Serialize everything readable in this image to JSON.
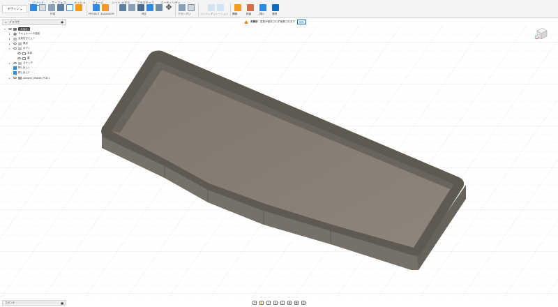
{
  "toolbar": {
    "workspace_label": "デザイン",
    "tabs": [
      {
        "label": "ソリッド",
        "active": true
      },
      {
        "label": "サーフェス",
        "active": false
      },
      {
        "label": "メッシュ",
        "active": false
      },
      {
        "label": "フォーム",
        "active": false
      },
      {
        "label": "シート メタル",
        "active": false
      },
      {
        "label": "プラスチック",
        "active": false
      },
      {
        "label": "ユーティリティ",
        "active": false
      }
    ],
    "groups": {
      "create": "作成",
      "project_salvador": "PROJECT SALVADOR",
      "modify": "修正",
      "assemble": "アセンブリ",
      "configure": "コンフィギュレーション",
      "construct": "構築",
      "inspect": "検査",
      "insert": "挿入",
      "select": "選択"
    }
  },
  "notification": {
    "label": "未解析",
    "message": "変更が保存されず破棄されます",
    "button": "保存"
  },
  "browser": {
    "title": "ブラウザ",
    "root_label": "(未保存)",
    "items": [
      {
        "label": "ドキュメントの設定",
        "type": "settings",
        "depth": 1
      },
      {
        "label": "名前付きビュー",
        "type": "folder",
        "depth": 1
      },
      {
        "label": "原点",
        "type": "folder",
        "depth": 1
      },
      {
        "label": "ボディ",
        "type": "folder",
        "depth": 1
      },
      {
        "label": "本体",
        "type": "body",
        "depth": 2
      },
      {
        "label": "蓋",
        "type": "body",
        "depth": 2
      },
      {
        "label": "スケッチ",
        "type": "folder",
        "depth": 1
      },
      {
        "label": "押し出し1",
        "type": "feature",
        "depth": 1
      },
      {
        "label": "押し出し2",
        "type": "feature",
        "depth": 1
      },
      {
        "label": "Akashic_Mobile_PCB 1",
        "type": "component",
        "depth": 1
      }
    ]
  },
  "comments": {
    "title": "コメント"
  },
  "navbar": {
    "icons": [
      "orbit-icon",
      "pan-icon",
      "look-at-icon",
      "zoom-icon",
      "zoom-window-icon",
      "display-settings-icon",
      "grid-icon",
      "viewports-icon"
    ]
  },
  "colors": {
    "accent": "#0a6dc2",
    "model_wall": "#6f6a60",
    "model_floor": "#837d72",
    "model_rim": "#605b52",
    "warning": "#e08a1e"
  }
}
